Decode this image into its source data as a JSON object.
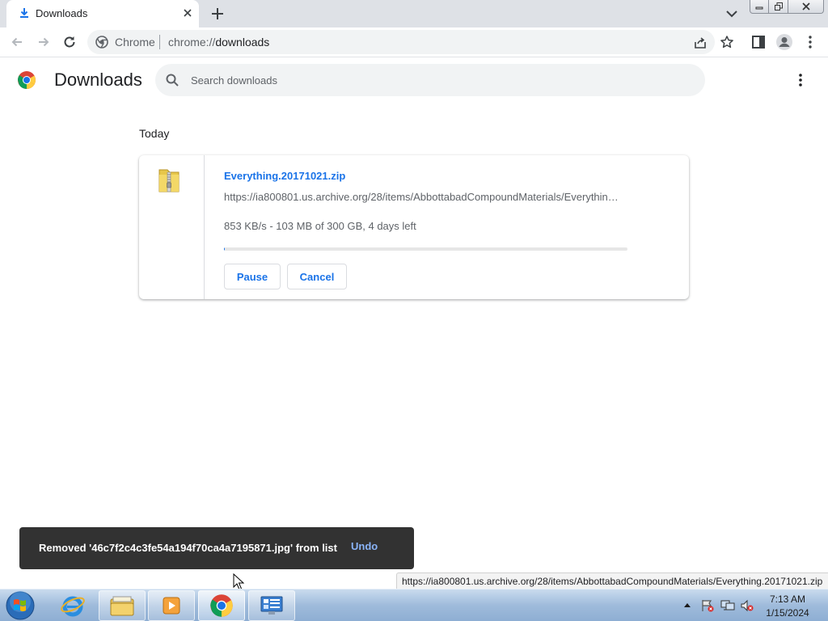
{
  "browser": {
    "tab": {
      "title": "Downloads"
    },
    "omnibox": {
      "site_label": "Chrome",
      "url_scheme": "chrome://",
      "url_host": "downloads"
    }
  },
  "page": {
    "title": "Downloads",
    "search": {
      "placeholder": "Search downloads",
      "value": ""
    },
    "sections": [
      {
        "date": "Today",
        "items": [
          {
            "filename": "Everything.20171021.zip",
            "url": "https://ia800801.us.archive.org/28/items/AbbottabadCompoundMaterials/Everythin…",
            "status": "853 KB/s - 103 MB of 300 GB, 4 days left",
            "progress": 0.0003,
            "buttons": {
              "pause": "Pause",
              "cancel": "Cancel"
            }
          }
        ]
      }
    ]
  },
  "toast": {
    "message": "Removed '46c7f2c4c3fe54a194f70ca4a7195871.jpg' from list",
    "action": "Undo"
  },
  "status_bar": {
    "url": "https://ia800801.us.archive.org/28/items/AbbottabadCompoundMaterials/Everything.20171021.zip"
  },
  "taskbar": {
    "apps": [
      "start-orb",
      "internet-explorer-icon",
      "file-explorer-icon",
      "media-player-icon",
      "chrome-icon",
      "control-panel-icon"
    ],
    "clock": {
      "time": "7:13 AM",
      "date": "1/15/2024"
    }
  },
  "colors": {
    "accent": "#1a73e8",
    "toast_bg": "#323232",
    "toast_action": "#8ab4f8"
  }
}
